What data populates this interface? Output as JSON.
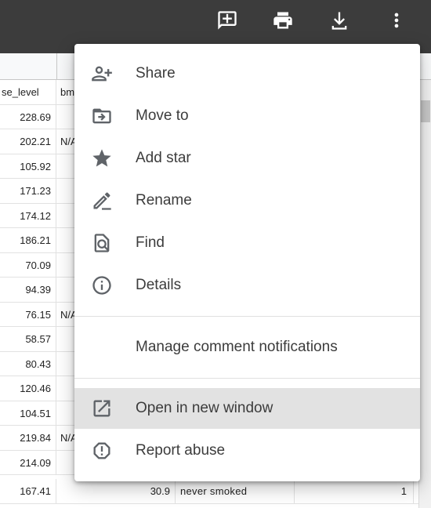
{
  "sheet": {
    "header": {
      "col1": "se_level",
      "col2": "bmi"
    },
    "rows": [
      {
        "glucose": "228.69",
        "bmi": "",
        "smoking": "",
        "stroke": ""
      },
      {
        "glucose": "202.21",
        "bmi": "N/A",
        "smoking": "",
        "stroke": ""
      },
      {
        "glucose": "105.92",
        "bmi": "",
        "smoking": "",
        "stroke": ""
      },
      {
        "glucose": "171.23",
        "bmi": "",
        "smoking": "",
        "stroke": ""
      },
      {
        "glucose": "174.12",
        "bmi": "",
        "smoking": "",
        "stroke": ""
      },
      {
        "glucose": "186.21",
        "bmi": "",
        "smoking": "",
        "stroke": ""
      },
      {
        "glucose": "70.09",
        "bmi": "",
        "smoking": "",
        "stroke": ""
      },
      {
        "glucose": "94.39",
        "bmi": "",
        "smoking": "",
        "stroke": ""
      },
      {
        "glucose": "76.15",
        "bmi": "N/A",
        "smoking": "",
        "stroke": ""
      },
      {
        "glucose": "58.57",
        "bmi": "",
        "smoking": "",
        "stroke": ""
      },
      {
        "glucose": "80.43",
        "bmi": "",
        "smoking": "",
        "stroke": ""
      },
      {
        "glucose": "120.46",
        "bmi": "",
        "smoking": "",
        "stroke": ""
      },
      {
        "glucose": "104.51",
        "bmi": "",
        "smoking": "",
        "stroke": ""
      },
      {
        "glucose": "219.84",
        "bmi": "N/A",
        "smoking": "",
        "stroke": ""
      },
      {
        "glucose": "214.09",
        "bmi": "",
        "smoking": "",
        "stroke": ""
      },
      {
        "glucose": "167.41",
        "bmi": "30.9",
        "smoking": "never smoked",
        "stroke": "1"
      }
    ]
  },
  "toolbar": {
    "icons": [
      "add-comment-icon",
      "print-icon",
      "download-icon",
      "more-vert-icon"
    ]
  },
  "menu": {
    "items": [
      {
        "label": "Share",
        "icon": "person-add-icon"
      },
      {
        "label": "Move to",
        "icon": "move-to-folder-icon"
      },
      {
        "label": "Add star",
        "icon": "star-icon"
      },
      {
        "label": "Rename",
        "icon": "rename-pencil-icon"
      },
      {
        "label": "Find",
        "icon": "find-in-page-icon"
      },
      {
        "label": "Details",
        "icon": "info-icon"
      },
      {
        "label": "Manage comment notifications",
        "icon": ""
      },
      {
        "label": "Open in new window",
        "icon": "open-in-new-icon"
      },
      {
        "label": "Report abuse",
        "icon": "report-icon"
      }
    ],
    "highlighted_item": "Open in new window"
  },
  "colors": {
    "toolbar_bg": "#3c3c3c",
    "menu_bg": "#ffffff",
    "highlight_bg": "#e2e2e2",
    "icon": "#5f6368"
  }
}
